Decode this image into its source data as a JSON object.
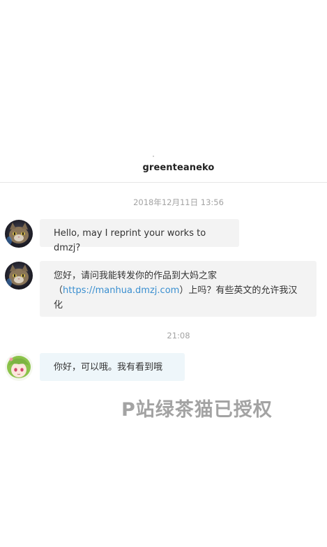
{
  "header": {
    "title": "greenteaneko"
  },
  "conversation": {
    "timestamps": [
      "2018年12月11日 13:56",
      "21:08"
    ],
    "messages": [
      {
        "sender": "cat-avatar",
        "text": "Hello, may I reprint your works to dmzj?"
      },
      {
        "sender": "cat-avatar",
        "text_before": "您好，请问我能转发你的作品到大妈之家",
        "paren_open": "（",
        "link": "https://manhua.dmzj.com",
        "text_after": "）上吗？有些英文的允许我汉化"
      },
      {
        "sender": "anime-avatar",
        "text": "你好，可以哦。我有看到哦"
      }
    ]
  },
  "watermark": {
    "text": "P站绿茶猫已授权"
  }
}
